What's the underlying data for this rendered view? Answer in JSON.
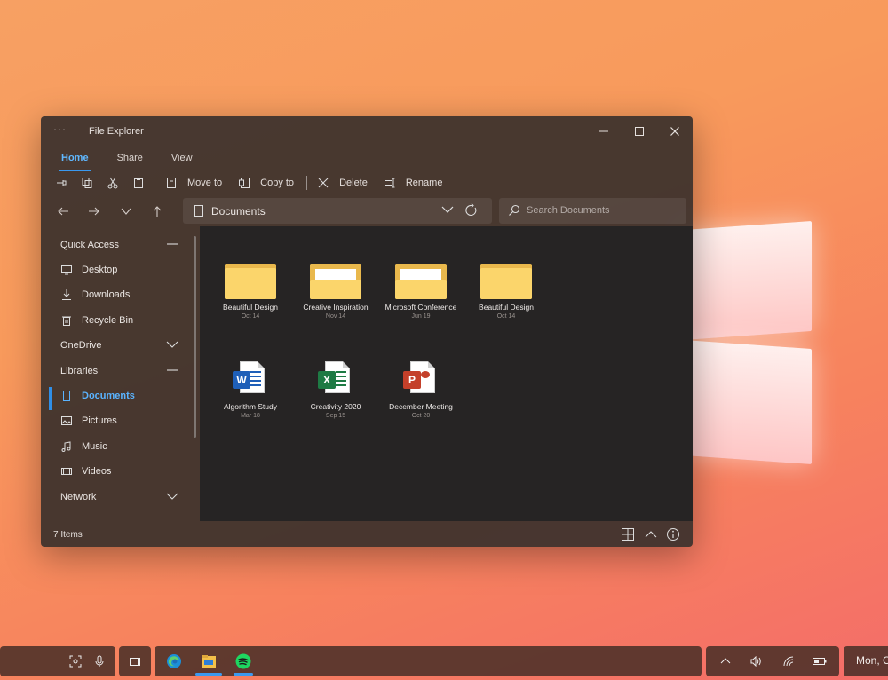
{
  "window": {
    "title": "File Explorer",
    "dots": "···"
  },
  "ribbon": {
    "tabs": [
      {
        "label": "Home",
        "active": true
      },
      {
        "label": "Share",
        "active": false
      },
      {
        "label": "View",
        "active": false
      }
    ],
    "actions": {
      "move_to": "Move to",
      "copy_to": "Copy to",
      "delete": "Delete",
      "rename": "Rename"
    }
  },
  "address": {
    "path": "Documents"
  },
  "search": {
    "placeholder": "Search Documents"
  },
  "sidebar": {
    "quick_access": "Quick Access",
    "desktop": "Desktop",
    "downloads": "Downloads",
    "recycle_bin": "Recycle Bin",
    "onedrive": "OneDrive",
    "libraries": "Libraries",
    "documents": "Documents",
    "pictures": "Pictures",
    "music": "Music",
    "videos": "Videos",
    "network": "Network"
  },
  "files": [
    {
      "name": "Beautiful Design",
      "date": "Oct 14",
      "type": "folder"
    },
    {
      "name": "Creative Inspiration",
      "date": "Nov 14",
      "type": "folder"
    },
    {
      "name": "Microsoft Conference",
      "date": "Jun 19",
      "type": "folder"
    },
    {
      "name": "Beautiful Design",
      "date": "Oct 14",
      "type": "folder"
    },
    {
      "name": "Algorithm Study",
      "date": "Mar 18",
      "type": "word"
    },
    {
      "name": "Creativity 2020",
      "date": "Sep 15",
      "type": "excel"
    },
    {
      "name": "December Meeting",
      "date": "Oct 20",
      "type": "powerpoint"
    }
  ],
  "status": {
    "item_count": "7 Items"
  },
  "taskbar": {
    "clock": "Mon, C"
  },
  "colors": {
    "accent": "#3a99f0",
    "folder": "#fbd56b",
    "word": "#1e5fb8",
    "excel": "#1e7a44",
    "powerpoint": "#c4402a",
    "spotify": "#1ed760"
  }
}
